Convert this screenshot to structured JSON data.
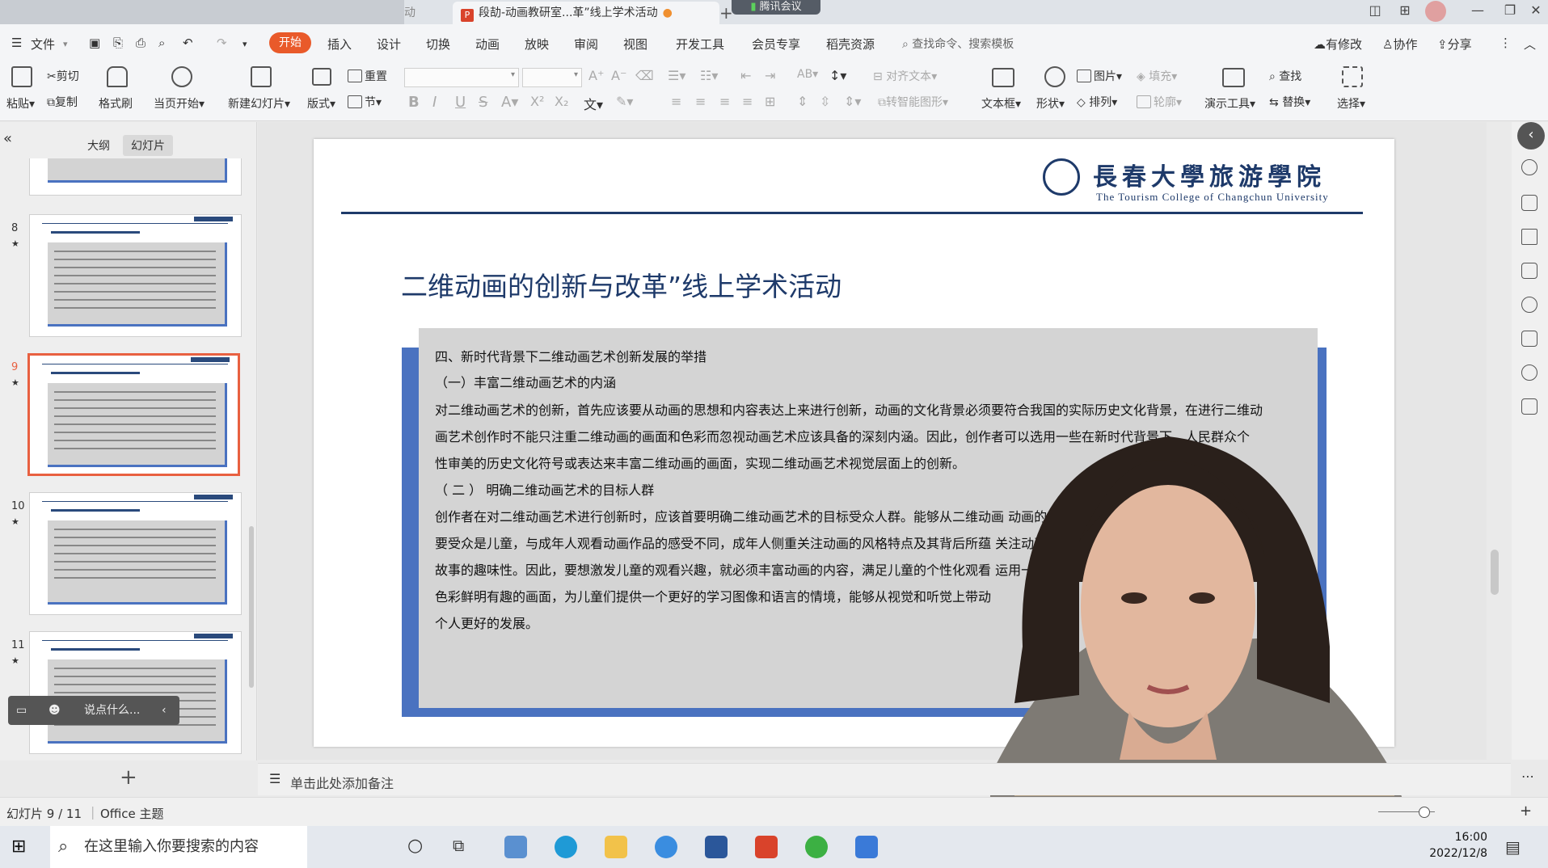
{
  "titlebar": {
    "inactive_tab": "动",
    "active_tab": "段劼-动画教研室...革”线上学术活动",
    "meeting_label": "腾讯会议",
    "minimize": "—",
    "restore": "❐",
    "close": "✕"
  },
  "menu": {
    "file": "文件",
    "items": [
      "开始",
      "插入",
      "设计",
      "切换",
      "动画",
      "放映",
      "审阅",
      "视图",
      "开发工具",
      "会员专享",
      "稻壳资源"
    ],
    "search_placeholder": "查找命令、搜索模板",
    "has_changes": "有修改",
    "collaborate": "协作",
    "share": "分享"
  },
  "ribbon": {
    "paste": "粘贴",
    "cut": "剪切",
    "copy": "复制",
    "format_painter": "格式刷",
    "play_from_current": "当页开始",
    "new_slide": "新建幻灯片",
    "layout": "版式",
    "reset": "重置",
    "section": "节",
    "align_text": "对齐文本",
    "smart_shape": "转智能图形",
    "text_box": "文本框",
    "shape": "形状",
    "picture": "图片",
    "fill": "填充",
    "arrange": "排列",
    "outline": "轮廓",
    "presenter_tools": "演示工具",
    "find": "查找",
    "replace": "替换",
    "select": "选择"
  },
  "left_panel": {
    "outline_tab": "大纲",
    "slides_tab": "幻灯片",
    "collapse": "«",
    "thumbnails": [
      {
        "num": "8",
        "star": "★"
      },
      {
        "num": "9",
        "star": "★"
      },
      {
        "num": "10",
        "star": "★"
      },
      {
        "num": "11",
        "star": "★"
      }
    ],
    "add_slide": "+",
    "chat_placeholder": "说点什么..."
  },
  "slide": {
    "logo_text": "長春大學旅游學院",
    "logo_subtitle": "The Tourism College of Changchun University",
    "title": "二维动画的创新与改革”线上学术活动",
    "lines": [
      "四、新时代背景下二维动画艺术创新发展的举措",
      "（一）丰富二维动画艺术的内涵",
      "对二维动画艺术的创新，首先应该要从动画的思想和内容表达上来进行创新，动画的文化背景必须要符合我国的实际历史文化背景，在进行二维动",
      "画艺术创作时不能只注重二维动画的画面和色彩而忽视动画艺术应该具备的深刻内涵。因此，创作者可以选用一些在新时代背景下，人民群众个",
      "性审美的历史文化符号或表达来丰富二维动画的画面，实现二维动画艺术视觉层面上的创新。",
      "（ 二 ） 明确二维动画艺术的目标人群",
      "创作者在对二维动画艺术进行创新时，应该首要明确二维动画艺术的目标受众人群。能够从二维动画                                          动画的主",
      "要受众是儿童，与成年人观看动画作品的感受不同，成年人侧重关注动画的风格特点及其背后所蕴                                          关注动画",
      "故事的趣味性。因此，要想激发儿童的观看兴趣，就必须丰富动画的内容，满足儿童的个性化观看                                          运用一些",
      "色彩鲜明有趣的画面，为儿童们提供一个更好的学习图像和语言的情境，能够从视觉和听觉上带动",
      "个人更好的发展。"
    ]
  },
  "notes": {
    "placeholder": "单击此处添加备注"
  },
  "status": {
    "slide_counter": "幻灯片 9 / 11",
    "theme": "Office 主题"
  },
  "taskbar": {
    "search_placeholder": "在这里输入你要搜索的内容",
    "time": "16:00",
    "date": "2022/12/8"
  },
  "colors": {
    "accent": "#e95a2a",
    "slide_navy": "#1e3a6a",
    "slide_blue": "#4a72c0",
    "slide_gray": "#d4d4d4"
  }
}
